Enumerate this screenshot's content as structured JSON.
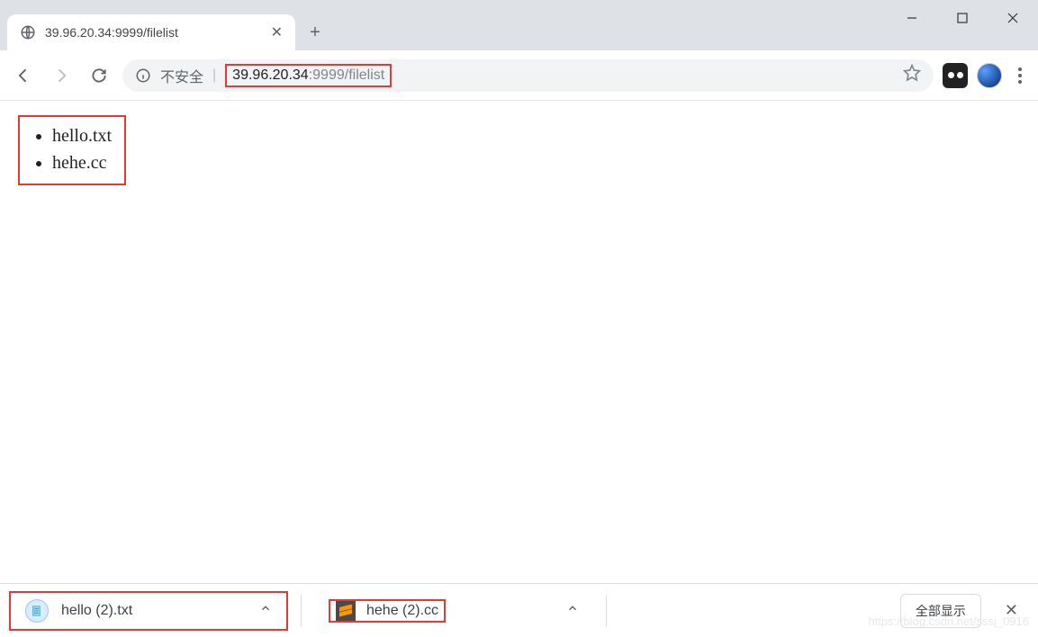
{
  "tab": {
    "title": "39.96.20.34:9999/filelist"
  },
  "address": {
    "not_secure": "不安全",
    "host": "39.96.20.34",
    "port": ":9999",
    "path": "/filelist"
  },
  "files": [
    "hello.txt",
    "hehe.cc"
  ],
  "downloads": {
    "items": [
      {
        "name": "hello (2).txt",
        "icon": "notepad"
      },
      {
        "name": "hehe (2).cc",
        "icon": "sublime"
      }
    ],
    "show_all": "全部显示"
  },
  "watermark": "https://blog.csdn.net/sssj_0916"
}
